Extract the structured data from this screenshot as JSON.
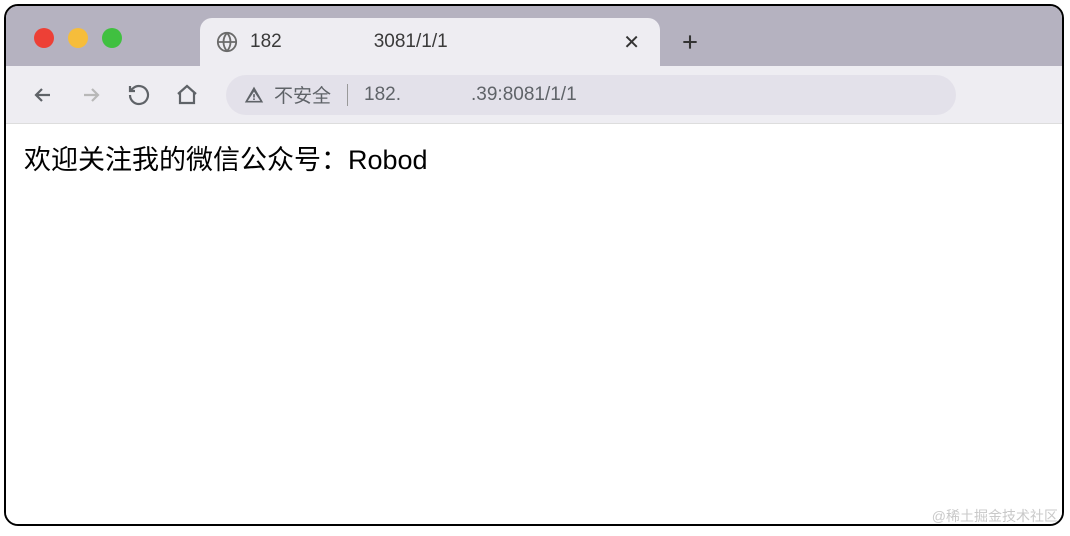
{
  "window": {
    "tab": {
      "title_prefix": "182",
      "title_suffix": "3081/1/1"
    }
  },
  "toolbar": {
    "insecure_label": "不安全",
    "url_prefix": "182.",
    "url_suffix": ".39:8081/1/1"
  },
  "page": {
    "body_text": "欢迎关注我的微信公众号：Robod"
  },
  "watermark": "@稀土掘金技术社区"
}
